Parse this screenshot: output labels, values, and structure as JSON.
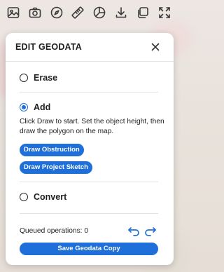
{
  "toolbar": {
    "icons": [
      "image-icon",
      "camera-icon",
      "compass-icon",
      "ruler-icon",
      "pie-chart-icon",
      "download-icon",
      "layers-copy-icon",
      "fullscreen-icon"
    ]
  },
  "panel": {
    "title": "EDIT GEODATA",
    "options": [
      {
        "label": "Erase",
        "selected": false
      },
      {
        "label": "Add",
        "selected": true
      },
      {
        "label": "Convert",
        "selected": false
      }
    ],
    "add_description": "Click Draw to start. Set the object height, then draw the polygon on the map.",
    "draw_obstruction_label": "Draw Obstruction",
    "draw_project_sketch_label": "Draw Project Sketch",
    "queued_label": "Queued operations: 0",
    "save_label": "Save Geodata Copy"
  },
  "colors": {
    "accent": "#1e6fd9",
    "panel_bg": "#ffffff",
    "text": "#1f1f1f",
    "divider": "#e2e2e2"
  }
}
